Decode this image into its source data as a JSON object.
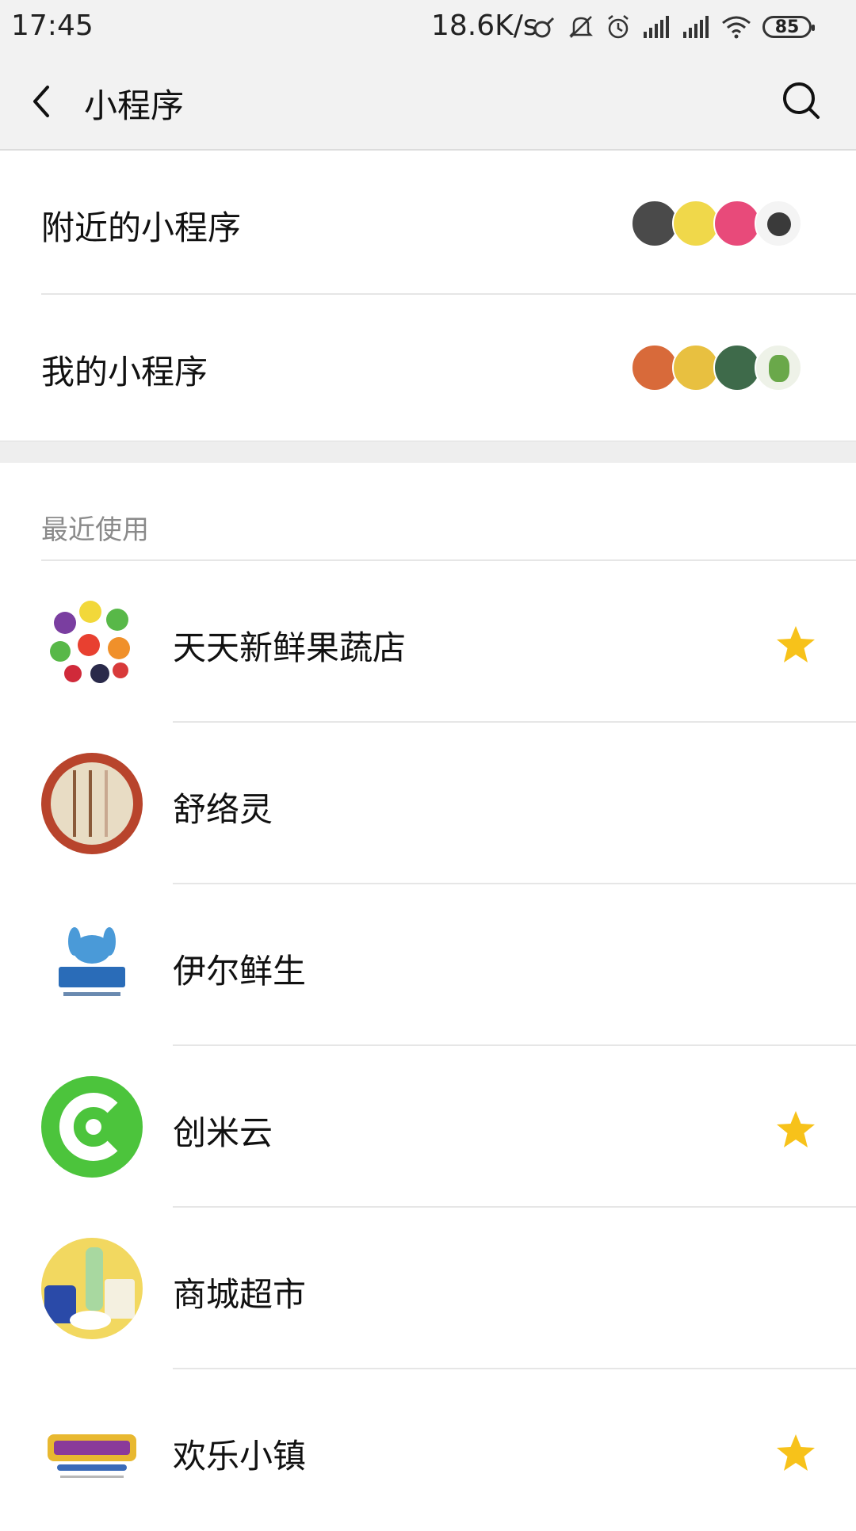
{
  "status_bar": {
    "time": "17:45",
    "net_rate": "18.6K/s",
    "battery": "85",
    "icons": [
      "link-icon",
      "mute-icon",
      "alarm-icon",
      "signal-icon",
      "signal-icon",
      "wifi-icon",
      "battery-icon"
    ]
  },
  "nav": {
    "title": "小程序",
    "back_icon": "chevron-left-icon",
    "search_icon": "search-icon"
  },
  "entries": [
    {
      "label": "附近的小程序",
      "avatar_colors": [
        "#4a4a4a",
        "#f0d84a",
        "#e84a7a",
        "#3a3a3a"
      ]
    },
    {
      "label": "我的小程序",
      "avatar_colors": [
        "#d86a3a",
        "#e8c040",
        "#3e6a4a",
        "#6aa84a"
      ]
    }
  ],
  "recent": {
    "title": "最近使用",
    "items": [
      {
        "name": "天天新鲜果蔬店",
        "starred": true,
        "icon_color": "#7cc84a"
      },
      {
        "name": "舒络灵",
        "starred": false,
        "icon_color": "#b8442c"
      },
      {
        "name": "伊尔鲜生",
        "starred": false,
        "icon_color": "#2a6cb8"
      },
      {
        "name": "创米云",
        "starred": true,
        "icon_color": "#4cc43c"
      },
      {
        "name": "商城超市",
        "starred": false,
        "icon_color": "#f2d860"
      },
      {
        "name": "欢乐小镇",
        "starred": true,
        "icon_color": "#e8b830"
      }
    ]
  },
  "colors": {
    "star": "#f7c21a",
    "header_bg": "#f2f2f2",
    "divider": "#e6e6e6"
  }
}
